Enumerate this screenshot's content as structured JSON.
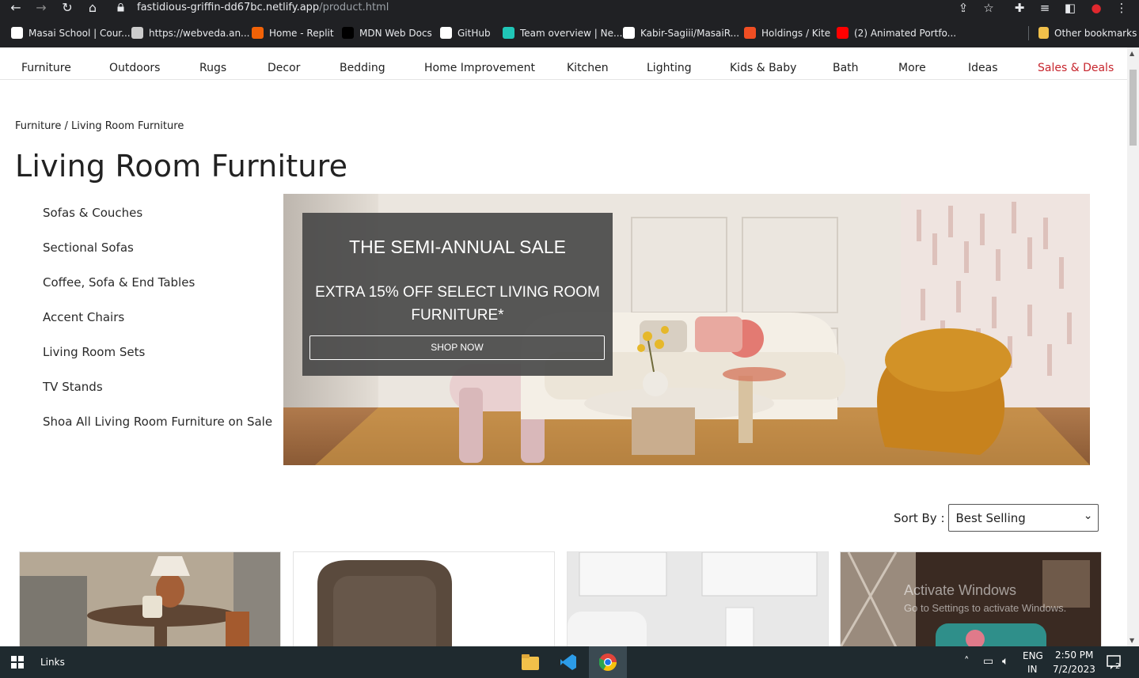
{
  "browser": {
    "url_domain": "fastidious-griffin-dd67bc.netlify.app",
    "url_path": "/product.html",
    "bookmarks": [
      {
        "label": "Masai School | Cour...",
        "color": "#ffffff"
      },
      {
        "label": "https://webveda.an...",
        "color": "#cccccc"
      },
      {
        "label": "Home - Replit",
        "color": "#f26207"
      },
      {
        "label": "MDN Web Docs",
        "color": "#000000"
      },
      {
        "label": "GitHub",
        "color": "#ffffff"
      },
      {
        "label": "Team overview | Ne...",
        "color": "#20c6b7"
      },
      {
        "label": "Kabir-Sagiii/MasaiR...",
        "color": "#ffffff"
      },
      {
        "label": "Holdings / Kite",
        "color": "#f04e23"
      },
      {
        "label": "(2) Animated Portfo...",
        "color": "#ff0000"
      }
    ],
    "other_bookmarks": "Other bookmarks",
    "icons": [
      "back-icon",
      "forward-icon",
      "reload-icon",
      "home-icon",
      "share-icon",
      "star-icon",
      "extensions-icon",
      "reading-list-icon",
      "side-panel-icon",
      "profile-icon",
      "menu-icon"
    ]
  },
  "nav": {
    "items": [
      "Furniture",
      "Outdoors",
      "Rugs",
      "Decor",
      "Bedding",
      "Home Improvement",
      "Kitchen",
      "Lighting",
      "Kids & Baby",
      "Bath",
      "More",
      "Ideas",
      "Sales & Deals"
    ],
    "sale_color": "#c7252d"
  },
  "breadcrumb": "Furniture / Living Room Furniture",
  "page_title": "Living Room Furniture",
  "categories": [
    "Sofas & Couches",
    "Sectional Sofas",
    "Coffee, Sofa & End Tables",
    "Accent Chairs",
    "Living Room Sets",
    "TV Stands",
    "Shoa All Living Room Furniture on Sale"
  ],
  "promo": {
    "headline": "THE SEMI-ANNUAL SALE",
    "subline": "EXTRA 15% OFF SELECT LIVING ROOM FURNITURE*",
    "button": "SHOP NOW"
  },
  "sort": {
    "label": "Sort By :",
    "selected": "Best Selling"
  },
  "watermark": {
    "line1": "Activate Windows",
    "line2": "Go to Settings to activate Windows."
  },
  "taskbar": {
    "links_label": "Links",
    "lang": "ENG",
    "region": "IN",
    "time": "2:50 PM",
    "date": "7/2/2023",
    "notification_count": "2"
  }
}
